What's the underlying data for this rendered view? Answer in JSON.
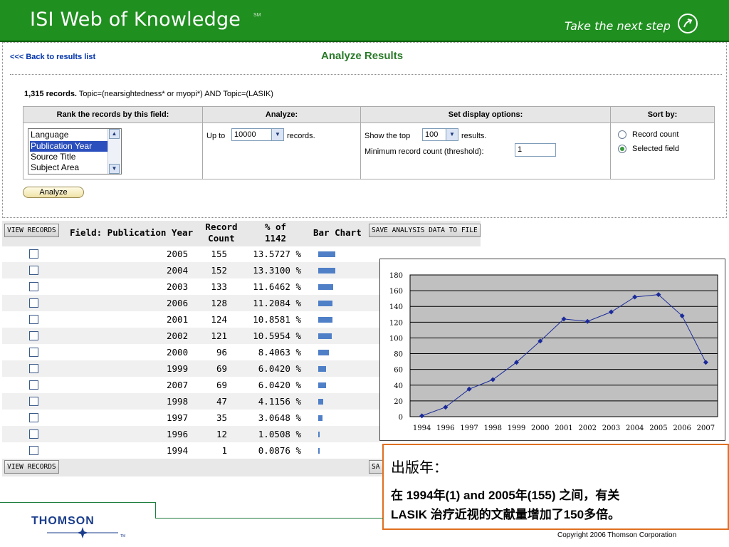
{
  "header": {
    "brand": "ISI Web of Knowledge",
    "brand_mark": "SM",
    "tagline": "Take the next step",
    "arrow_icon": "arrow-up-right-circle-icon",
    "bg_color": "#1f8f1f"
  },
  "analyze": {
    "back_link": "<<< Back to results list",
    "title": "Analyze Results",
    "records_count": "1,315 records.",
    "query": "Topic=(nearsightedness* or myopi*) AND Topic=(LASIK)",
    "headers": [
      "Rank the records by this field:",
      "Analyze:",
      "Set display options:",
      "Sort by:"
    ],
    "field_options": [
      "Language",
      "Publication Year",
      "Source Title",
      "Subject Area"
    ],
    "selected_field": "Publication Year",
    "up_to_label": "Up to",
    "up_to_value": "10000",
    "records_label": "records.",
    "show_top_label": "Show the top",
    "show_top_value": "100",
    "results_label": "results.",
    "threshold_label": "Minimum record count (threshold):",
    "threshold_value": "1",
    "sort_options": [
      "Record count",
      "Selected field"
    ],
    "sort_selected": "Selected field",
    "analyze_button": "Analyze"
  },
  "results": {
    "view_records": "VIEW RECORDS",
    "field_header": "Field: Publication Year",
    "record_count_header": [
      "Record",
      "Count"
    ],
    "percent_header": [
      "% of",
      "1142"
    ],
    "bar_chart_header": "Bar Chart",
    "save_button": "SAVE ANALYSIS DATA TO FILE",
    "save_button_partial": "SA",
    "rows": [
      {
        "year": "2005",
        "count": "155",
        "pct": "13.5727 %",
        "frac": 0.1357
      },
      {
        "year": "2004",
        "count": "152",
        "pct": "13.3100 %",
        "frac": 0.1331
      },
      {
        "year": "2003",
        "count": "133",
        "pct": "11.6462 %",
        "frac": 0.1165
      },
      {
        "year": "2006",
        "count": "128",
        "pct": "11.2084 %",
        "frac": 0.1121
      },
      {
        "year": "2001",
        "count": "124",
        "pct": "10.8581 %",
        "frac": 0.1086
      },
      {
        "year": "2002",
        "count": "121",
        "pct": "10.5954 %",
        "frac": 0.106
      },
      {
        "year": "2000",
        "count": "96",
        "pct": "8.4063 %",
        "frac": 0.0841
      },
      {
        "year": "1999",
        "count": "69",
        "pct": "6.0420 %",
        "frac": 0.0604
      },
      {
        "year": "2007",
        "count": "69",
        "pct": "6.0420 %",
        "frac": 0.0604
      },
      {
        "year": "1998",
        "count": "47",
        "pct": "4.1156 %",
        "frac": 0.0412
      },
      {
        "year": "1997",
        "count": "35",
        "pct": "3.0648 %",
        "frac": 0.0306
      },
      {
        "year": "1996",
        "count": "12",
        "pct": "1.0508 %",
        "frac": 0.0105
      },
      {
        "year": "1994",
        "count": "1",
        "pct": "0.0876 %",
        "frac": 0.0009
      }
    ]
  },
  "chart_data": {
    "type": "line",
    "x": [
      "1994",
      "1996",
      "1997",
      "1998",
      "1999",
      "2000",
      "2001",
      "2002",
      "2003",
      "2004",
      "2005",
      "2006",
      "2007"
    ],
    "series": [
      {
        "values": [
          1,
          12,
          35,
          47,
          69,
          96,
          124,
          121,
          133,
          152,
          155,
          128,
          69
        ]
      }
    ],
    "yticks": [
      "0",
      "20",
      "40",
      "60",
      "80",
      "100",
      "120",
      "140",
      "160",
      "180"
    ],
    "ylim": [
      0,
      180
    ],
    "grid": true,
    "plot_bg": "#c0c0c0",
    "line_color": "#1a2a9a"
  },
  "note": {
    "title": "出版年：",
    "line1": "在 1994年(1) and 2005年(155) 之间，有关",
    "line2": "LASIK 治疗近视的文献量增加了150多倍。",
    "border_color": "#e07020"
  },
  "footer": {
    "logo": "THOMSON",
    "logo_mark": "TM",
    "copyright": "Copyright 2006 Thomson Corporation"
  }
}
